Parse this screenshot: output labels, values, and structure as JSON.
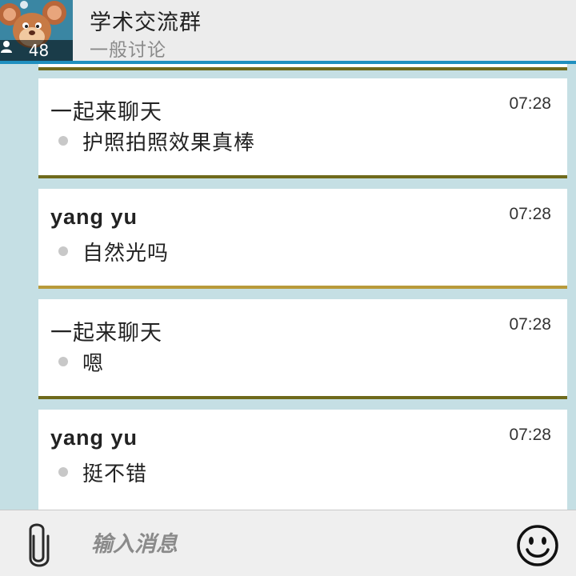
{
  "header": {
    "title": "学术交流群",
    "subtitle": "一般讨论",
    "member_count": "48",
    "avatar_icon": "cartoon-mouse-avatar",
    "accent_color": "#1f8fbf"
  },
  "messages": [
    {
      "sender": "一起来聊天",
      "time": "07:28",
      "text": "护照拍照效果真棒",
      "accent": "#6f6a1c"
    },
    {
      "sender": "yang yu",
      "time": "07:28",
      "text": "自然光吗",
      "accent": "#b89a3a"
    },
    {
      "sender": "一起来聊天",
      "time": "07:28",
      "text": "嗯",
      "accent": "#6f6a1c"
    },
    {
      "sender": "yang yu",
      "time": "07:28",
      "text": "挺不错",
      "accent": "#6f6a1c"
    }
  ],
  "composer": {
    "placeholder": "输入消息",
    "attach_icon": "paperclip-icon",
    "emoji_icon": "smiley-icon"
  }
}
